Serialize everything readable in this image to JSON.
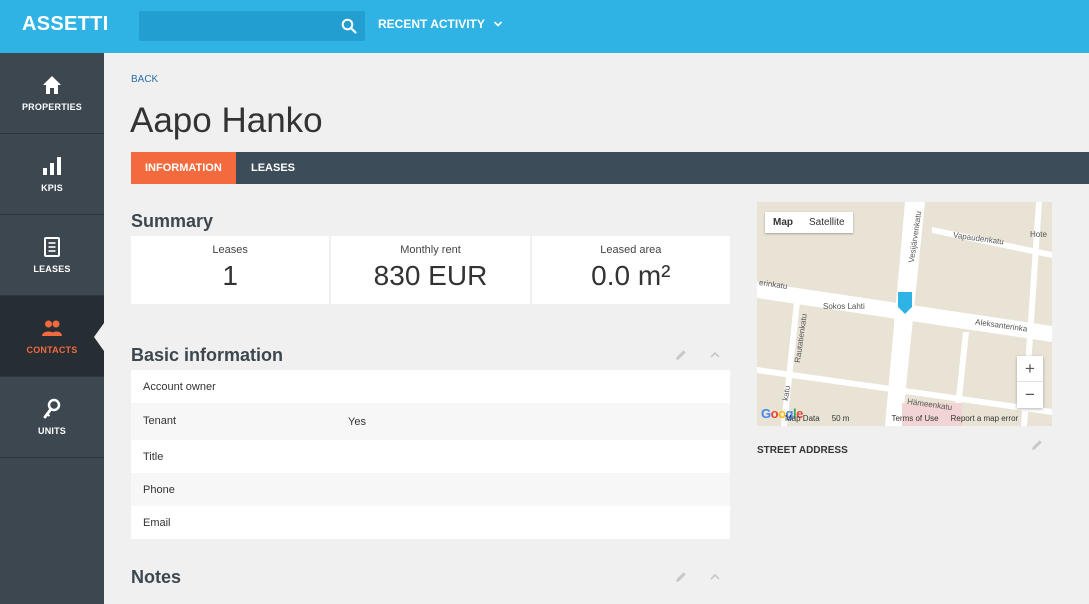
{
  "app": {
    "logo": "ASSETTI"
  },
  "header": {
    "recent_activity": "RECENT ACTIVITY"
  },
  "sidebar": {
    "items": [
      {
        "label": "PROPERTIES"
      },
      {
        "label": "KPIS"
      },
      {
        "label": "LEASES"
      },
      {
        "label": "CONTACTS"
      },
      {
        "label": "UNITS"
      }
    ]
  },
  "page": {
    "back": "BACK",
    "title": "Aapo Hanko",
    "tabs": [
      {
        "label": "INFORMATION"
      },
      {
        "label": "LEASES"
      }
    ]
  },
  "summary": {
    "title": "Summary",
    "cards": [
      {
        "label": "Leases",
        "value": "1"
      },
      {
        "label": "Monthly rent",
        "value": "830 EUR"
      },
      {
        "label": "Leased area",
        "value": "0.0 m²"
      }
    ]
  },
  "basic_info": {
    "title": "Basic information",
    "rows": [
      {
        "key": "Account owner",
        "value": ""
      },
      {
        "key": "Tenant",
        "value": "Yes"
      },
      {
        "key": "Title",
        "value": ""
      },
      {
        "key": "Phone",
        "value": ""
      },
      {
        "key": "Email",
        "value": ""
      }
    ]
  },
  "notes": {
    "title": "Notes"
  },
  "map": {
    "type_map": "Map",
    "type_satellite": "Satellite",
    "zoom_in": "+",
    "zoom_out": "−",
    "google": "Google",
    "footer_data": "Map Data",
    "footer_scale": "50 m",
    "footer_terms": "Terms of Use",
    "footer_report": "Report a map error",
    "streets": {
      "vesijarvenkatu": "Vesijärvenkatu",
      "vapaudenkatu": "Vapaudenkatu",
      "hote": "Hote",
      "erinkatu": "erinkatu",
      "sokos": "Sokos Lahti",
      "aleksanterinka": "Aleksanterinka",
      "rautatienkatu": "Rautatienkatu",
      "hameenkatu": "Hämeenkatu",
      "katu": "katu"
    },
    "street_address_label": "STREET ADDRESS"
  },
  "colors": {
    "accent": "#f26a3d",
    "topbar": "#2eb3e4",
    "sidebar": "#3c474f",
    "tabs": "#3c4c58"
  }
}
